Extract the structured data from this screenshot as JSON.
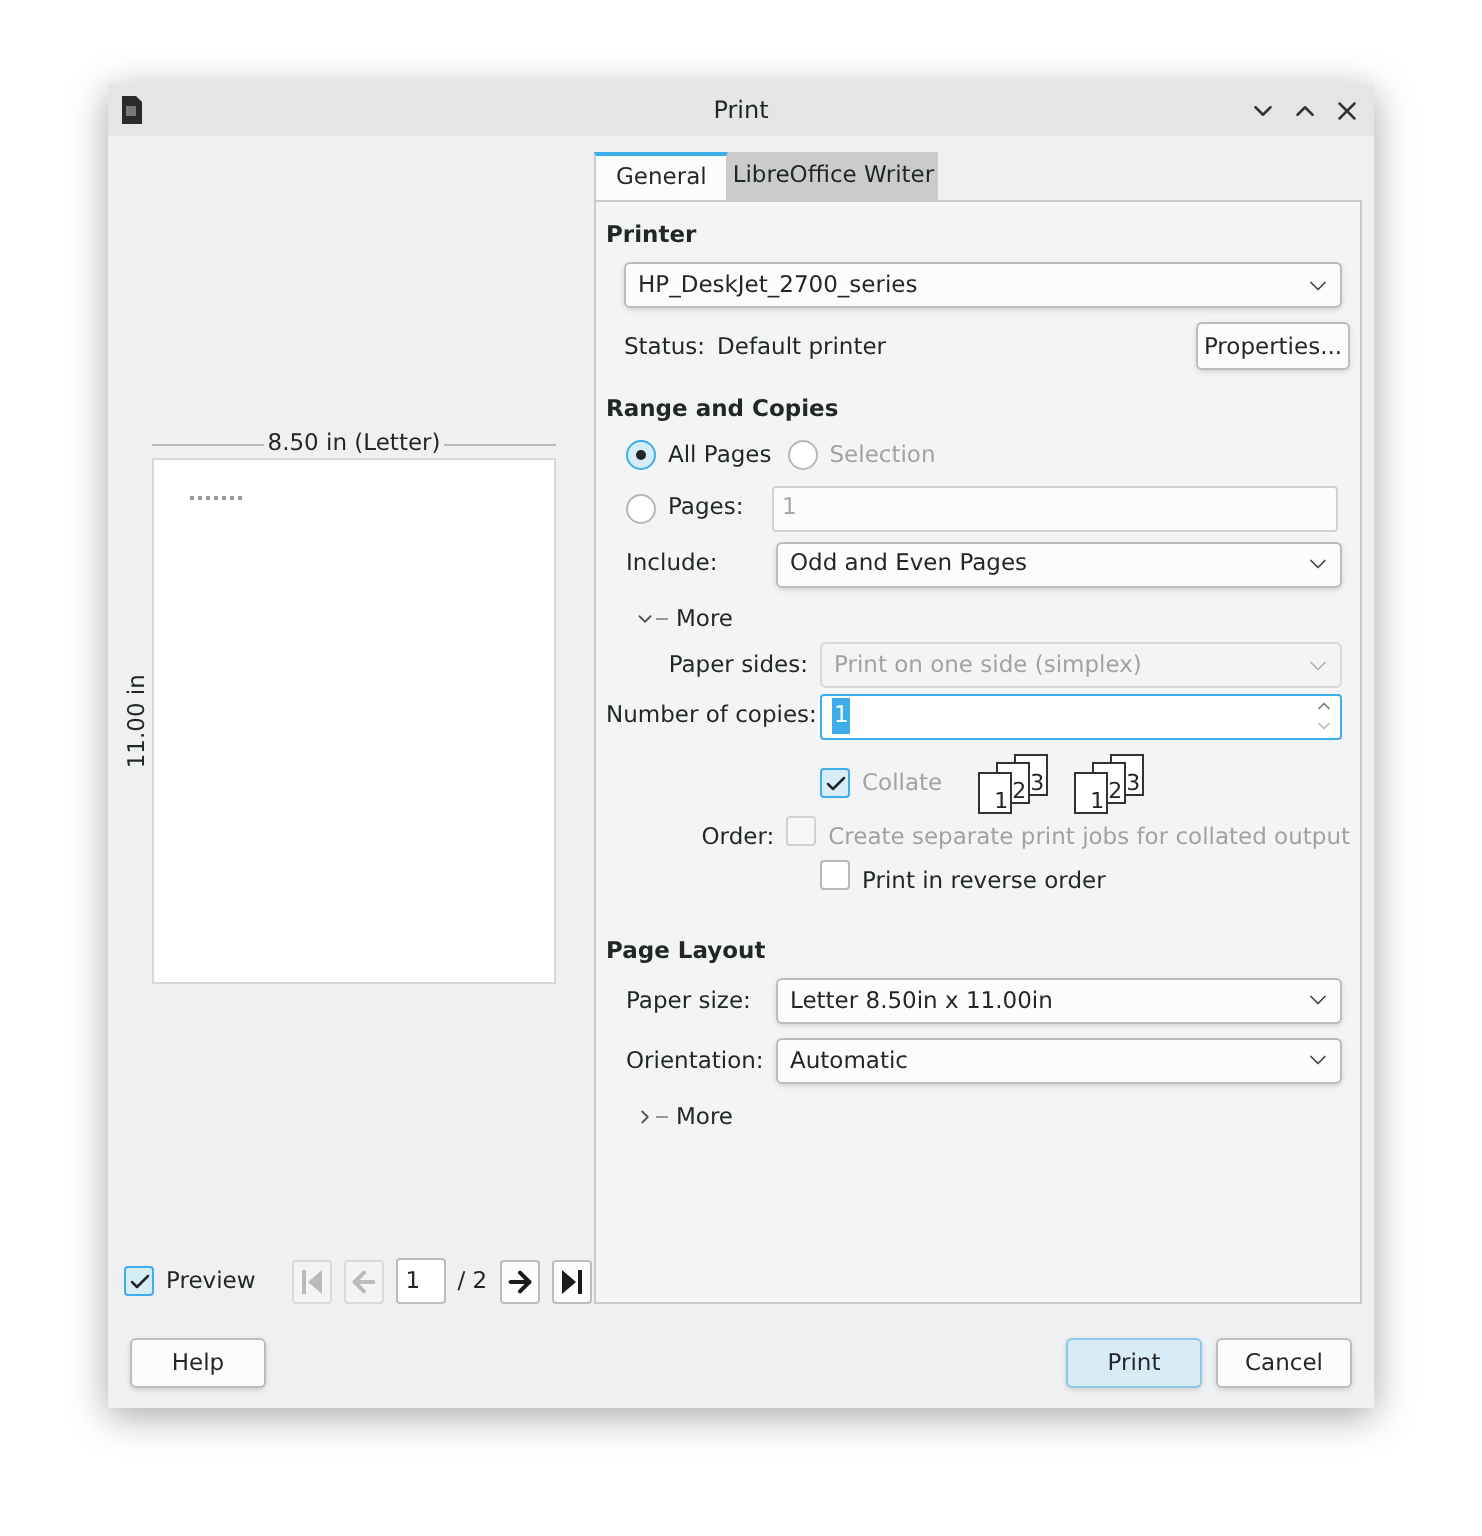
{
  "window": {
    "title": "Print"
  },
  "tabs": [
    {
      "label": "General",
      "selected": true
    },
    {
      "label": "LibreOffice Writer",
      "selected": false
    }
  ],
  "preview": {
    "width_label": "8.50 in (Letter)",
    "height_label": "11.00 in",
    "checkbox": {
      "label": "Preview",
      "checked": true
    },
    "page": "1",
    "page_count": "/ 2",
    "nav": [
      {
        "kind": "first",
        "disabled": true
      },
      {
        "kind": "prev",
        "disabled": true
      },
      {
        "kind": "next",
        "disabled": false
      },
      {
        "kind": "last",
        "disabled": false
      }
    ]
  },
  "printer": {
    "heading": "Printer",
    "selected": "HP_DeskJet_2700_series",
    "status_label": "Status:",
    "status": "Default printer",
    "properties_button": "Properties..."
  },
  "range": {
    "heading": "Range and Copies",
    "options": [
      {
        "label": "All Pages",
        "selected": true,
        "disabled": false
      },
      {
        "label": "Selection",
        "selected": false,
        "disabled": true
      }
    ],
    "pages_option": {
      "label": "Pages:",
      "selected": false
    },
    "pages_value": "1",
    "include": {
      "label": "Include:",
      "value": "Odd and Even Pages"
    },
    "more": {
      "label": "More",
      "expanded": true
    },
    "paper_sides": {
      "label": "Paper sides:",
      "value": "Print on one side (simplex)",
      "disabled": true
    },
    "copies": {
      "label": "Number of copies:",
      "value": "1"
    },
    "collate": {
      "label": "Collate",
      "checked": true,
      "disabled": true,
      "icons": [
        [
          "1",
          "2",
          "3"
        ],
        [
          "1",
          "2",
          "3"
        ]
      ]
    },
    "order_label": "Order:",
    "order_options": [
      {
        "label": "Create separate print jobs for collated output",
        "checked": false,
        "disabled": true
      },
      {
        "label": "Print in reverse order",
        "checked": false,
        "disabled": false
      }
    ]
  },
  "layout": {
    "heading": "Page Layout",
    "paper_size": {
      "label": "Paper size:",
      "value": "Letter 8.50in x 11.00in"
    },
    "orientation": {
      "label": "Orientation:",
      "value": "Automatic"
    },
    "more": {
      "label": "More",
      "expanded": false
    }
  },
  "buttons": {
    "help": "Help",
    "print": "Print",
    "cancel": "Cancel"
  }
}
